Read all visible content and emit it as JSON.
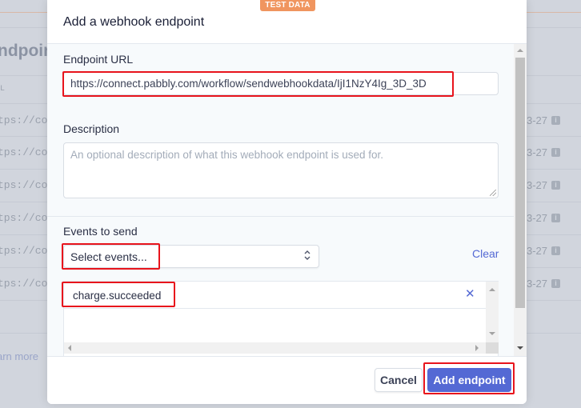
{
  "background": {
    "page_title_fragment": "ndpoin",
    "column_header_fragment": "L",
    "rows": [
      {
        "url_fragment": "tps://co",
        "date_fragment": "3-27"
      },
      {
        "url_fragment": "tps://co",
        "date_fragment": "3-27"
      },
      {
        "url_fragment": "tps://co",
        "date_fragment": "3-27"
      },
      {
        "url_fragment": "tps://co",
        "date_fragment": "3-27"
      },
      {
        "url_fragment": "tps://co",
        "date_fragment": "3-27"
      },
      {
        "url_fragment": "tps://co",
        "date_fragment": "3-27"
      }
    ],
    "info_icon_glyph": "i",
    "learn_more_fragment": "arn more"
  },
  "modal": {
    "badge": "TEST DATA",
    "title": "Add a webhook endpoint",
    "endpoint_url": {
      "label": "Endpoint URL",
      "value": "https://connect.pabbly.com/workflow/sendwebhookdata/IjI1NzY4Ig_3D_3D"
    },
    "description": {
      "label": "Description",
      "placeholder": "An optional description of what this webhook endpoint is used for.",
      "value": ""
    },
    "events": {
      "label": "Events to send",
      "select_placeholder": "Select events...",
      "clear_label": "Clear",
      "selected": [
        {
          "name": "charge.succeeded",
          "remove_glyph": "✕"
        }
      ]
    },
    "footer": {
      "cancel_label": "Cancel",
      "submit_label": "Add endpoint"
    }
  },
  "colors": {
    "accent": "#5469d4",
    "badge": "#f0955f",
    "annotation": "#e8141c"
  }
}
